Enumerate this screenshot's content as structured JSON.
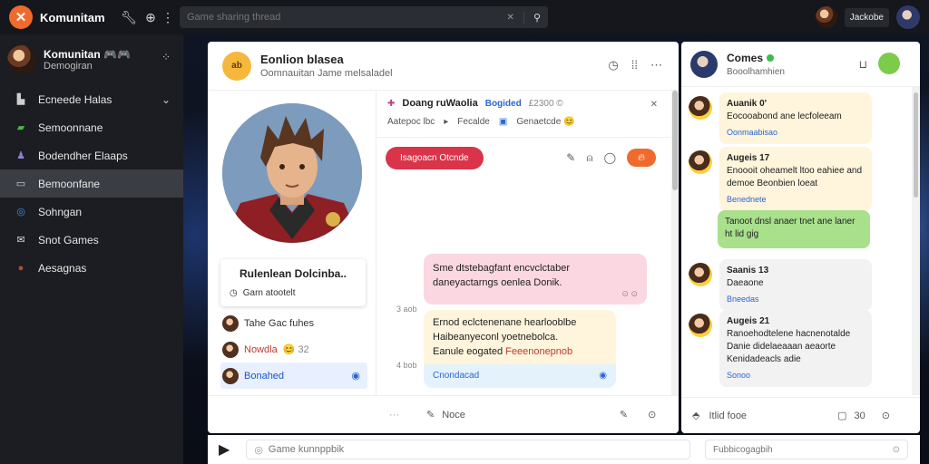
{
  "app": {
    "title": "Komunitam",
    "logo_glyph": "✕",
    "accent": "#ef6a2c"
  },
  "search": {
    "placeholder": "Game sharing thread"
  },
  "top_user": {
    "name": "Jackobe"
  },
  "sidebar": {
    "profile_name": "Komunitan",
    "profile_badges": "🎮🎮",
    "profile_sub": "Demogiran",
    "items": [
      {
        "label": "Ecneede Halas",
        "icon": "controller-icon",
        "color": "#cfcfcf",
        "chevron": "⌄"
      },
      {
        "label": "Semoonnane",
        "icon": "chat-icon",
        "color": "#4fb34a"
      },
      {
        "label": "Bodendher Elaaps",
        "icon": "group-icon",
        "color": "#8f7fcf"
      },
      {
        "label": "Bemoonfane",
        "icon": "folder-icon",
        "color": "#d8d8d8",
        "active": true
      },
      {
        "label": "Sohngan",
        "icon": "ring-icon",
        "color": "#3f8fe0"
      },
      {
        "label": "Snot Games",
        "icon": "mail-icon",
        "color": "#d8d8d8"
      },
      {
        "label": "Aesagnas",
        "icon": "avatar-icon",
        "color": "#b05030"
      }
    ]
  },
  "main": {
    "group_avatar_text": "ab",
    "title": "Eonlion blasea",
    "subtitle": "Oomnauitan  Jame melsaladel",
    "profile_card": {
      "name": "Rulenlean Dolcinba..",
      "role": "Garn atootelt"
    },
    "profile_list": [
      {
        "label": "Tahe Gac fuhes"
      },
      {
        "label": "Nowdla",
        "extra": "😊 32"
      },
      {
        "label": "Bonahed",
        "selected": true
      }
    ],
    "thread": {
      "name": "Doang ruWaolia",
      "tag": "Bogided",
      "count": "£2300 ©",
      "line2_a": "Aatepoc lbc",
      "line2_b": "Fecalde",
      "line2_c": "Genaetcde 😊"
    },
    "pill_label": "Isagoacn Otcnde",
    "messages": [
      {
        "time": "3 aob",
        "text": "Sme dtstebagfant encvclctaber daneyactarngs oenlea Donik.",
        "reacts": "⊙ ⊙"
      },
      {
        "time": "4 bob",
        "lines": [
          "Ernod eclctenenane hearlooblbe",
          "Haibeanyeconl yoetnebolca.",
          "Eanule eogated"
        ],
        "link": "Feeenonepnob",
        "foot": "Cnondacad"
      }
    ],
    "footer_note": "Noce"
  },
  "right": {
    "title": "Comes",
    "subtitle": "Booolhamhien",
    "messages": [
      {
        "name": "Auanik 0'",
        "text": "Eocooabond ane lecfoleeam",
        "meta": "Oonmaabisao",
        "bg": "#fff4dc"
      },
      {
        "name": "Augeis 17",
        "text": "Enoooit oheamelt ltoo eahiee and demoe Beonbien loeat",
        "meta": "Benednete",
        "bg": "#fff4dc"
      },
      {
        "name": "",
        "text": "Tanoot dnsl anaer tnet ane laner ht lid gig",
        "meta": "",
        "bg": "#a9e08c"
      },
      {
        "name": "Saanis 13",
        "text": "Daeaone",
        "meta": "Bneedas",
        "bg": "#f2f2f2"
      },
      {
        "name": "Augeis 21",
        "text": "Ranoehodtelene hacnenotalde Danie didelaeaaan aeaorte Kenidadeacls adie",
        "meta": "Sonoo",
        "bg": "#f2f2f2"
      }
    ],
    "footer_label": "Itlid fooe",
    "footer_count": "30"
  },
  "composer": {
    "placeholder": "Game kunnppbik",
    "secondary_placeholder": "Fubbicogagbih"
  }
}
